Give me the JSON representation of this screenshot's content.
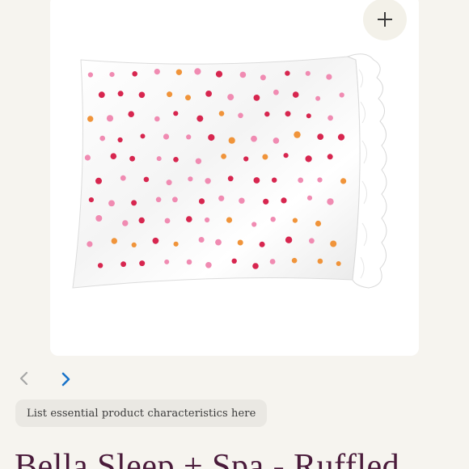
{
  "gallery": {
    "zoom_icon": "plus-icon",
    "prev_icon": "chevron-left-icon",
    "next_icon": "chevron-right-icon",
    "product_image_subject": "white satin ruffled pillowcase with pink, red and orange polka dots"
  },
  "info_chip": {
    "label": "List essential product characteristics here"
  },
  "product": {
    "title": "Bella Sleep + Spa - Ruffled"
  },
  "colors": {
    "background": "#f6f4ef",
    "title": "#4a1b3b",
    "next_arrow": "#1a73c9",
    "prev_arrow": "#a7a7a7",
    "dot_red": "#d7264f",
    "dot_pink": "#f08bb2",
    "dot_orange": "#f0943a"
  }
}
